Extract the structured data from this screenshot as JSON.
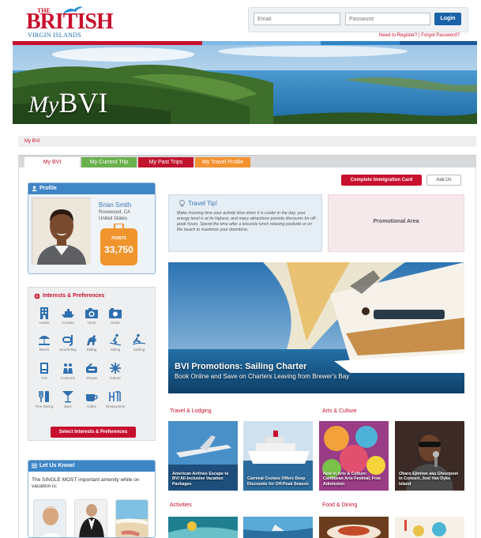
{
  "brand": {
    "logo_the": "THE",
    "logo_british": "BRITISH",
    "logo_vi": "VIRGIN ISLANDS"
  },
  "login": {
    "email_placeholder": "Email",
    "password_placeholder": "Password",
    "button": "Login",
    "register_link": "Need to Register?  |  Forgot Password?"
  },
  "colors": {
    "brand_red": "#c8102e",
    "brand_blue": "#1a63a8",
    "tab_green": "#6ab04c",
    "tab_red": "#c0142f",
    "tab_orange": "#f39230"
  },
  "hero": {
    "title_my": "My",
    "title_bvi": "BVI"
  },
  "breadcrumb": "My BVI",
  "tabs": [
    {
      "label": "My BVI",
      "color": "#ffffff",
      "active": true
    },
    {
      "label": "My Current Trip",
      "color": "#6ab04c"
    },
    {
      "label": "My Past Trips",
      "color": "#c0142f"
    },
    {
      "label": "My Travel Profile",
      "color": "#f39230"
    }
  ],
  "profile": {
    "heading": "Profile",
    "name": "Brian Smith",
    "city": "Rosewood, CA",
    "country": "United States",
    "points_label": "POINTS",
    "points": "33,750"
  },
  "interests": {
    "heading": "Interests & Preferences",
    "items": [
      {
        "label": "Hotels",
        "icon": "hotel-icon"
      },
      {
        "label": "Cruises",
        "icon": "cruise-icon"
      },
      {
        "label": "Tours",
        "icon": "camera-icon"
      },
      {
        "label": "Deals",
        "icon": "deals-icon"
      },
      {
        "label": "Beach",
        "icon": "beach-icon"
      },
      {
        "label": "Snorkeling",
        "icon": "snorkel-icon"
      },
      {
        "label": "Riding",
        "icon": "horse-icon"
      },
      {
        "label": "Skiing",
        "icon": "ski-icon"
      },
      {
        "label": "Surfing",
        "icon": "surf-icon"
      },
      {
        "label": "Arts",
        "icon": "arts-icon"
      },
      {
        "label": "Concerts",
        "icon": "concert-icon"
      },
      {
        "label": "Shows",
        "icon": "shows-icon"
      },
      {
        "label": "Nature",
        "icon": "nature-icon"
      },
      {
        "label": "Fine Dining",
        "icon": "dining-icon"
      },
      {
        "label": "Bars",
        "icon": "cocktail-icon"
      },
      {
        "label": "Cafes",
        "icon": "coffee-icon"
      },
      {
        "label": "Restaurants",
        "icon": "restaurant-icon"
      }
    ],
    "button": "Select Interests & Preferences"
  },
  "letusknow": {
    "heading": "Let Us Know!",
    "question": "The SINGLE MOST important amenity while on vacation is:"
  },
  "actions": {
    "immigration": "Complete Immigration Card",
    "ask": "Ask Us"
  },
  "tip": {
    "title": "Travel Tip!",
    "body": "Make morning time your activity time when it is cooler in the day, your energy level is at its highest, and many attractions provide discounts for off-peak hours. Spend the time after a leisurely lunch relaxing poolside or on the beach to maximize your downtime."
  },
  "promo": {
    "label": "Promotional Area"
  },
  "banner": {
    "title": "BVI Promotions: Sailing Charter",
    "subtitle": "Book Online and Save on Charters Leaving from Brewer's Bay"
  },
  "sections": {
    "travel": "Travel & Lodging",
    "arts": "Arts & Culture",
    "activities": "Activities",
    "food": "Food & Dining"
  },
  "cards": [
    {
      "caption": "American Airlines Escape to BVI All-Inclusive Vacation Packages"
    },
    {
      "caption": "Carnival Cruises Offers Deep Discounts for Off-Peak Season"
    },
    {
      "caption": "New in Arts & Culture: Caribbean Arts Festival, Free Admission"
    },
    {
      "caption": "Obaro Ejimiwe aka Ghostpoet in Concert, Jost Van Dyke Island"
    }
  ]
}
